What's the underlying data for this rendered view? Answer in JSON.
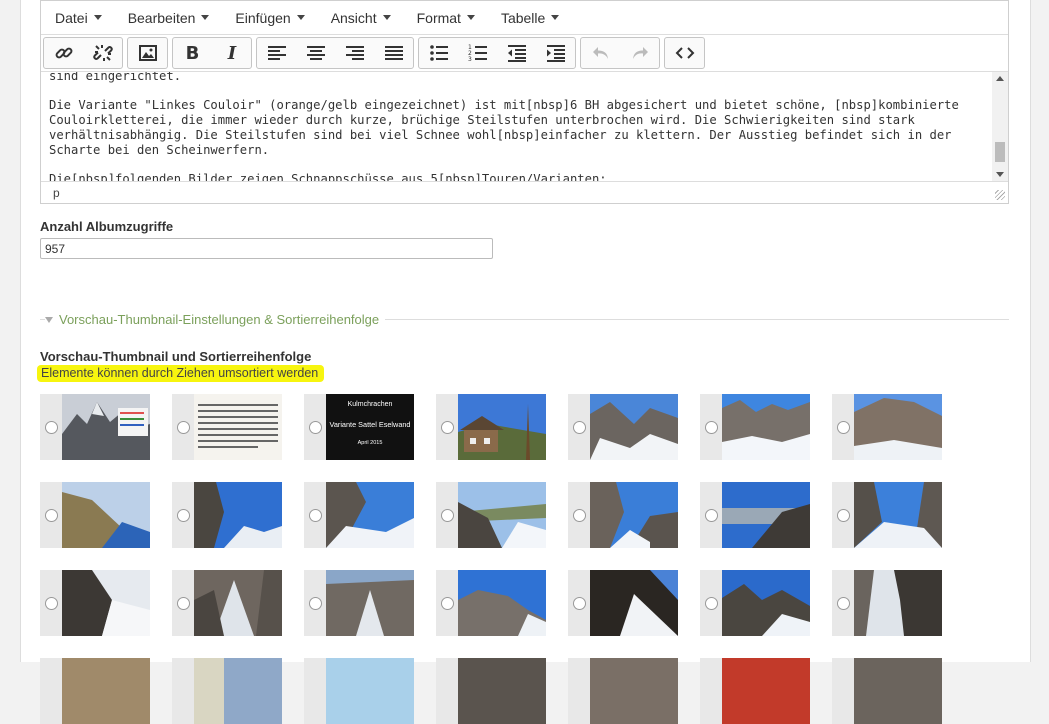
{
  "menubar": {
    "items": [
      {
        "label": "Datei"
      },
      {
        "label": "Bearbeiten"
      },
      {
        "label": "Einfügen"
      },
      {
        "label": "Ansicht"
      },
      {
        "label": "Format"
      },
      {
        "label": "Tabelle"
      }
    ]
  },
  "toolbar": {
    "bold_label": "B",
    "italic_label": "I",
    "icons": [
      "link-icon",
      "unlink-icon",
      "image-icon",
      "bold-icon",
      "italic-icon",
      "align-left-icon",
      "align-center-icon",
      "align-right-icon",
      "align-justify-icon",
      "bullet-list-icon",
      "numbered-list-icon",
      "outdent-icon",
      "indent-icon",
      "undo-icon",
      "redo-icon",
      "source-code-icon"
    ]
  },
  "editor": {
    "paragraphs": [
      "sind eingerichtet.",
      "Die Variante \"Linkes Couloir\" (orange/gelb eingezeichnet) ist mit[nbsp]6 BH abgesichert und bietet schöne, [nbsp]kombinierte Couloirkletterei, die immer wieder durch kurze, brüchige Steilstufen unterbrochen wird. Die Schwierigkeiten sind stark verhältnisabhängig. Die Steilstufen sind bei viel Schnee wohl[nbsp]einfacher zu klettern. Der Ausstieg befindet sich in der Scharte bei den Scheinwerfern.",
      "Die[nbsp]folgenden Bilder zeigen Schnappschüsse aus 5[nbsp]Touren/Varianten:"
    ],
    "status_path": "p"
  },
  "album_views": {
    "label": "Anzahl Albumzugriffe",
    "value": "957"
  },
  "fieldset": {
    "legend": "Vorschau-Thumbnail-Einstellungen & Sortierreihenfolge"
  },
  "thumbnails": {
    "title": "Vorschau-Thumbnail und Sortierreihenfolge",
    "hint": "Elemente können durch Ziehen umsortiert werden",
    "title_card": {
      "line1": "Kulmchrachen",
      "line2": "Variante Sattel Eselwand",
      "line3": "April 2015"
    }
  },
  "colors": {
    "accent_green": "#7ba05b",
    "hint_highlight": "#f7f50f"
  }
}
